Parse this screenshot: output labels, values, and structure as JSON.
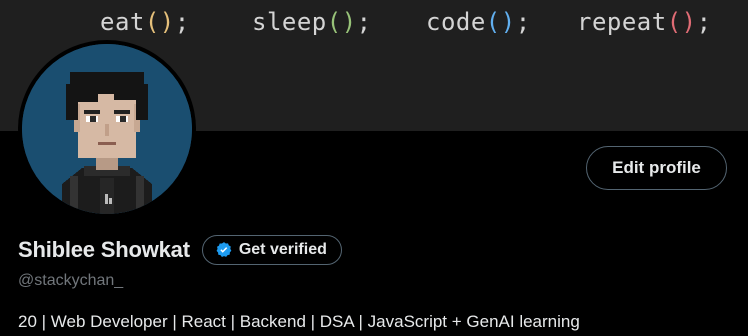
{
  "banner": {
    "code_words": [
      {
        "word": "eat",
        "paren": "()",
        "semi": ";"
      },
      {
        "word": "sleep",
        "paren": "()",
        "semi": ";"
      },
      {
        "word": "code",
        "paren": "()",
        "semi": ";"
      },
      {
        "word": "repeat",
        "paren": "()",
        "semi": ";"
      }
    ],
    "colors": {
      "background": "#1f1f1f",
      "text": "#d4d4d4",
      "paren_eat": "#e5c07b",
      "paren_sleep": "#98c379",
      "paren_code": "#61afef",
      "paren_repeat": "#e06c75"
    }
  },
  "profile": {
    "display_name": "Shiblee Showkat",
    "handle": "@stackychan_",
    "bio": "20 | Web Developer | React | Backend | DSA | JavaScript + GenAI learning",
    "verify_label": "Get verified",
    "edit_label": "Edit profile",
    "avatar_icon": "pixel-art-avatar",
    "verified_icon": "verified-badge-icon"
  },
  "colors": {
    "page_bg": "#000000",
    "text": "#e7e9ea",
    "muted": "#71767b",
    "border": "#536471",
    "verified_blue": "#1d9bf0",
    "avatar_bg": "#1a4e70"
  }
}
